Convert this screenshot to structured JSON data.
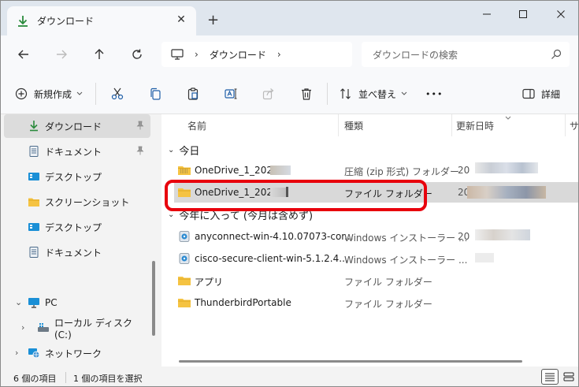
{
  "window": {
    "tab_title": "ダウンロード",
    "new_tab": "+",
    "minimize": "—",
    "maximize": "☐",
    "close": "✕"
  },
  "nav": {
    "breadcrumb": [
      "ダウンロード"
    ],
    "search_placeholder": "ダウンロードの検索"
  },
  "toolbar": {
    "new_label": "新規作成",
    "sort_label": "並べ替え",
    "more_label": "•••",
    "details_label": "詳細"
  },
  "sidebar": {
    "items": [
      {
        "label": "ダウンロード",
        "icon": "download-icon",
        "pinned": true,
        "selected": true
      },
      {
        "label": "ドキュメント",
        "icon": "document-icon",
        "pinned": true
      },
      {
        "label": "デスクトップ",
        "icon": "desktop-icon"
      },
      {
        "label": "スクリーンショット",
        "icon": "folder-icon"
      },
      {
        "label": "デスクトップ",
        "icon": "desktop-icon"
      },
      {
        "label": "ドキュメント",
        "icon": "document-icon"
      },
      {
        "label": "PC",
        "icon": "pc-icon",
        "expanded": true
      },
      {
        "label": "ローカル ディスク (C:)",
        "icon": "drive-icon"
      },
      {
        "label": "ネットワーク",
        "icon": "network-icon"
      }
    ]
  },
  "columns": {
    "name": "名前",
    "type": "種類",
    "modified": "更新日時",
    "size": "サ"
  },
  "groups": [
    {
      "label": "今日",
      "rows": [
        {
          "name": "OneDrive_1_2024-",
          "type": "圧縮 (zip 形式) フォルダー",
          "date": "20",
          "icon": "zip-folder-icon"
        },
        {
          "name": "OneDrive_1_2024-",
          "type": "ファイル フォルダー",
          "date": "20",
          "icon": "folder-icon",
          "selected": true
        }
      ]
    },
    {
      "label": "今年に入って (今月は含めず)",
      "rows": [
        {
          "name": "anyconnect-win-4.10.07073-cor...",
          "type": "Windows インストーラー ...",
          "date": "20",
          "icon": "installer-icon"
        },
        {
          "name": "cisco-secure-client-win-5.1.2.4...",
          "type": "Windows インストーラー ...",
          "date": "",
          "icon": "installer-icon"
        },
        {
          "name": "アプリ",
          "type": "ファイル フォルダー",
          "date": "",
          "icon": "folder-icon"
        },
        {
          "name": "ThunderbirdPortable",
          "type": "ファイル フォルダー",
          "date": "",
          "icon": "folder-icon"
        }
      ]
    }
  ],
  "status": {
    "item_count": "6 個の項目",
    "selected_count": "1 個の項目を選択"
  },
  "colors": {
    "highlight": "#e8000c",
    "folder": "#f5c342",
    "accent": "#2a8a3c"
  }
}
